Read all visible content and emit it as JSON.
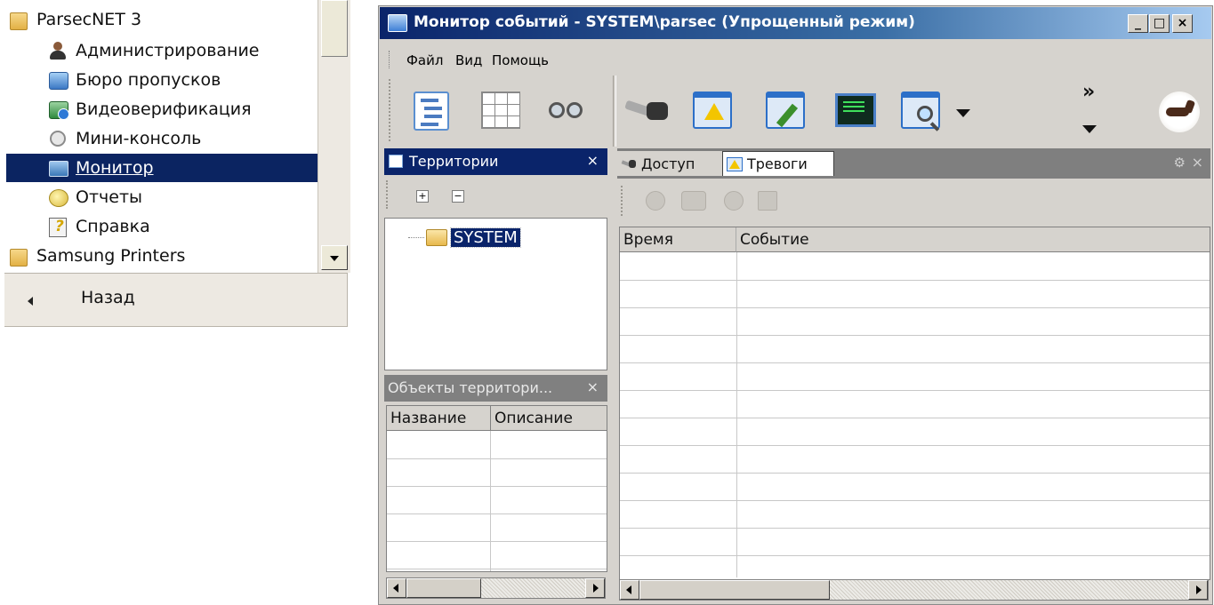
{
  "start_menu": {
    "folder": "ParsecNET 3",
    "items": [
      {
        "label": "Администрирование",
        "icon": "user-admin-icon"
      },
      {
        "label": "Бюро пропусков",
        "icon": "badge-office-icon"
      },
      {
        "label": "Видеоверификация",
        "icon": "video-verification-icon"
      },
      {
        "label": "Мини-консоль",
        "icon": "mini-console-icon"
      },
      {
        "label": "Монитор",
        "icon": "monitor-icon",
        "selected": true
      },
      {
        "label": "Отчеты",
        "icon": "reports-icon"
      },
      {
        "label": "Справка",
        "icon": "help-icon"
      }
    ],
    "folder2": "Samsung Printers",
    "back_label": "Назад"
  },
  "window": {
    "title": "Монитор событий - SYSTEM\\parsec (Упрощенный режим)",
    "caption_buttons": {
      "minimize": "_",
      "maximize": "□",
      "close": "×"
    },
    "menu": [
      "Файл",
      "Вид",
      "Помощь"
    ],
    "toolbar_overflow": "»",
    "territories_pane": {
      "title": "Территории",
      "close": "×",
      "expand": "+",
      "collapse": "−",
      "node": "SYSTEM"
    },
    "objects_pane": {
      "title": "Объекты территори...",
      "close": "×",
      "columns": [
        "Название",
        "Описание"
      ]
    },
    "events_pane": {
      "tabs": [
        {
          "label": "Доступ",
          "icon": "key-icon",
          "active": false
        },
        {
          "label": "Тревоги",
          "icon": "alarm-icon",
          "active": true
        }
      ],
      "gear": "⚙",
      "close": "×",
      "columns": [
        "Время",
        "Событие"
      ]
    }
  }
}
